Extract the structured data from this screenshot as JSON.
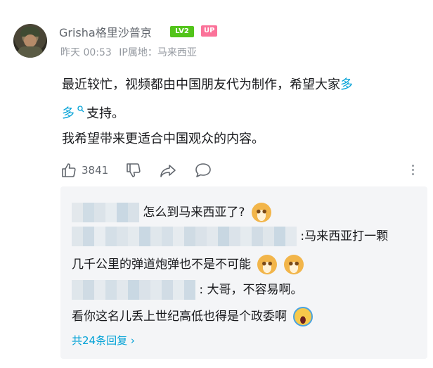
{
  "user": {
    "name": "Grisha格里沙普京",
    "level": "LV2",
    "up_badge": "UP"
  },
  "meta": {
    "time": "昨天 00:53",
    "ip": "IP属地：马来西亚"
  },
  "comment": {
    "line1_a": "最近较忙，视频都由中国朋友代为制作，希望大家",
    "line1_link": "多",
    "line2_link": "多",
    "line2_b": "支持。",
    "line3": "我希望带来更适合中国观众的内容。"
  },
  "actions": {
    "like_count": "3841"
  },
  "replies": {
    "r1_text": "怎么到马来西亚了?",
    "r2_text": ":马来西亚打一颗",
    "r3_text": "几千公里的弹道炮弹也不是不可能",
    "r4_text": ": 大哥，不容易啊。",
    "r5_text": "看你这名儿丢上世纪高低也得是个政委啊",
    "count_label": "共24条回复",
    "chevron": "›"
  },
  "icons": [
    "thumb-up-icon",
    "thumb-down-icon",
    "share-icon",
    "comment-icon",
    "more-icon",
    "search-icon",
    "dog-emoji-icon",
    "crying-emoji-icon"
  ],
  "colors": {
    "link": "#00a1d6",
    "level_badge": "#52c41a",
    "up_badge": "#fb7299",
    "reply_bg": "#f4f5f7"
  }
}
